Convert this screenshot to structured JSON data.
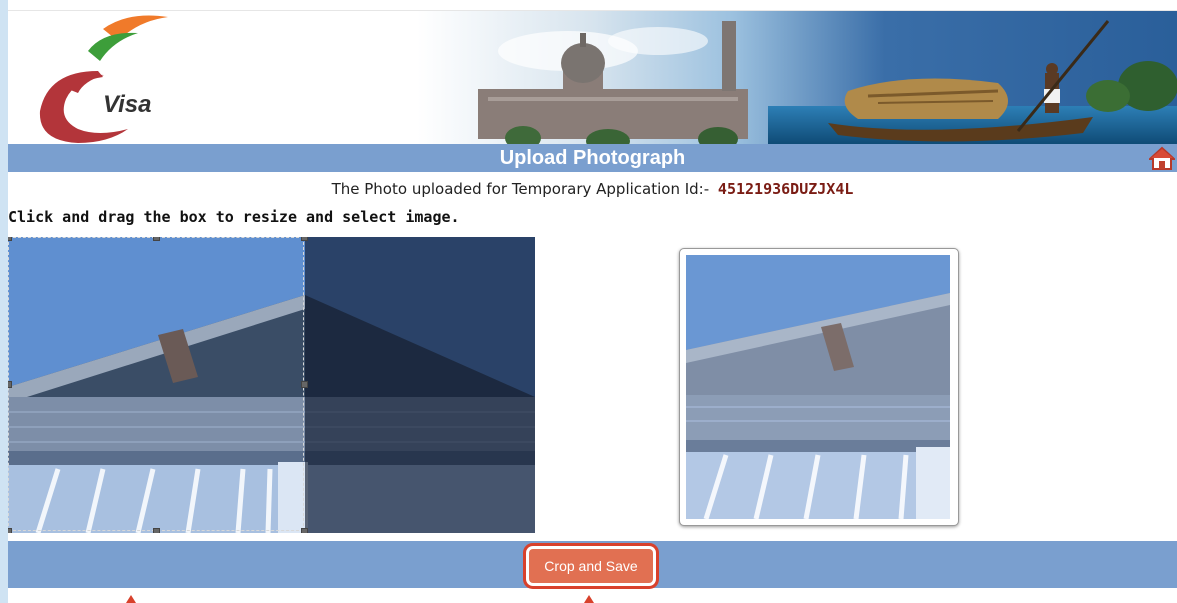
{
  "banner": {
    "logo_text": "Visa",
    "logo_alt": "e-Visa"
  },
  "page": {
    "title": "Upload Photograph",
    "info_prefix": "The Photo uploaded for Temporary Application Id:-",
    "application_id": "45121936DUZJX4L",
    "instruction": "Click and drag the box to resize and select image."
  },
  "actions": {
    "crop_save_label": "Crop and Save"
  },
  "colors": {
    "bar": "#7a9fcf",
    "button": "#e17052",
    "highlight": "#d8412c",
    "app_id": "#7a1c14"
  },
  "icons": {
    "home": "home-icon"
  }
}
